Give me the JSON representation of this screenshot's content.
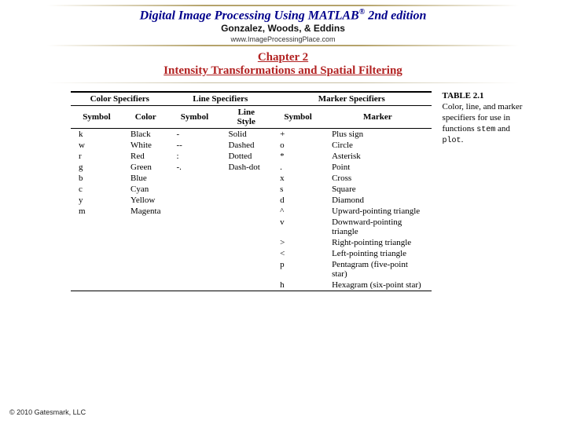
{
  "header": {
    "title_pre": "Digital Image Processing Using MATLAB",
    "reg": "®",
    "title_post": "  2nd edition",
    "authors": "Gonzalez, Woods, & Eddins",
    "url": "www.ImageProcessingPlace.com"
  },
  "chapter": {
    "line1": "Chapter 2",
    "line2": "Intensity Transformations and Spatial Filtering"
  },
  "table": {
    "group_headers": [
      "Color Specifiers",
      "Line Specifiers",
      "Marker Specifiers"
    ],
    "sub_headers": [
      "Symbol",
      "Color",
      "Symbol",
      "Line Style",
      "Symbol",
      "Marker"
    ],
    "rows": [
      [
        "k",
        "Black",
        "-",
        "Solid",
        "+",
        "Plus sign"
      ],
      [
        "w",
        "White",
        "--",
        "Dashed",
        "o",
        "Circle"
      ],
      [
        "r",
        "Red",
        ":",
        "Dotted",
        "*",
        "Asterisk"
      ],
      [
        "g",
        "Green",
        "-.",
        "Dash-dot",
        ".",
        "Point"
      ],
      [
        "b",
        "Blue",
        "",
        "",
        "x",
        "Cross"
      ],
      [
        "c",
        "Cyan",
        "",
        "",
        "s",
        "Square"
      ],
      [
        "y",
        "Yellow",
        "",
        "",
        "d",
        "Diamond"
      ],
      [
        "m",
        "Magenta",
        "",
        "",
        "^",
        "Upward-pointing triangle"
      ],
      [
        "",
        "",
        "",
        "",
        "v",
        "Downward-pointing triangle"
      ],
      [
        "",
        "",
        "",
        "",
        ">",
        "Right-pointing triangle"
      ],
      [
        "",
        "",
        "",
        "",
        "<",
        "Left-pointing triangle"
      ],
      [
        "",
        "",
        "",
        "",
        "p",
        "Pentagram (five-point star)"
      ],
      [
        "",
        "",
        "",
        "",
        "h",
        "Hexagram (six-point star)"
      ]
    ]
  },
  "caption": {
    "label": "TABLE 2.1",
    "text1": "Color, line, and marker specifiers for use in functions ",
    "fn1": "stem",
    "text2": " and ",
    "fn2": "plot",
    "text3": "."
  },
  "footer": {
    "copyright": "© 2010 Gatesmark, LLC"
  }
}
